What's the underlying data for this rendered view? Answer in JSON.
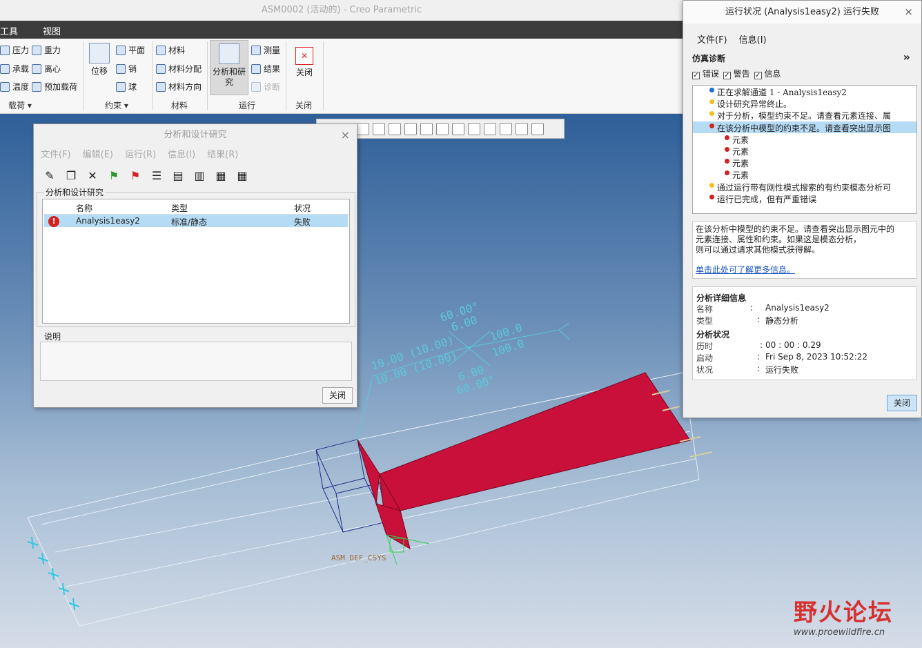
{
  "app": {
    "title": "ASM0002 (活动的) - Creo Parametric",
    "menus": [
      "工具",
      "视图"
    ]
  },
  "ribbon": {
    "loads": {
      "items": [
        "压力",
        "重力",
        "承载",
        "离心",
        "温度",
        "预加载荷"
      ],
      "group": "载荷 ▾"
    },
    "constraints": {
      "big": "位移",
      "items": [
        "平面",
        "销",
        "球"
      ],
      "group": "约束 ▾"
    },
    "materials": {
      "items": [
        "材料",
        "材料分配",
        "材料方向"
      ],
      "group": "材料"
    },
    "run": {
      "big": "分析和研究",
      "items": [
        "测量",
        "结果",
        "诊断"
      ],
      "group": "运行"
    },
    "close": {
      "big": "关闭",
      "group": "关闭"
    }
  },
  "dialog_studies": {
    "title": "分析和设计研究",
    "close": "×",
    "menus": [
      "文件(F)",
      "编辑(E)",
      "运行(R)",
      "信息(I)",
      "结果(R)"
    ],
    "group_label": "分析和设计研究",
    "columns": [
      "名称",
      "类型",
      "状况"
    ],
    "rows": [
      {
        "name": "Analysis1easy2",
        "type": "标准/静态",
        "status": "失败"
      }
    ],
    "desc_label": "说明",
    "close_button": "关闭"
  },
  "dialog_status": {
    "title": "运行状况 (Analysis1easy2) 运行失败",
    "close": "×",
    "menus": [
      "文件(F)",
      "信息(I)"
    ],
    "section": "仿真诊断",
    "expand": "»",
    "filters": [
      "错误",
      "警告",
      "信息"
    ],
    "messages": [
      {
        "text": "正在求解通道 1 - Analysis1easy2",
        "color": "#1a6fd6",
        "indent": 0
      },
      {
        "text": "设计研究异常终止。",
        "color": "#f0c020",
        "indent": 0
      },
      {
        "text": "对于分析，模型约束不足。请查看元素连接、属",
        "color": "#f0c020",
        "indent": 0
      },
      {
        "text": "在该分析中模型的约束不足。请查看突出显示图",
        "color": "#d42020",
        "indent": 0,
        "selected": true
      },
      {
        "text": "元素",
        "color": "#d42020",
        "indent": 1
      },
      {
        "text": "元素",
        "color": "#d42020",
        "indent": 1
      },
      {
        "text": "元素",
        "color": "#d42020",
        "indent": 1
      },
      {
        "text": "元素",
        "color": "#d42020",
        "indent": 1
      },
      {
        "text": "通过运行带有刚性模式搜索的有约束模态分析可",
        "color": "#f0c020",
        "indent": 0
      },
      {
        "text": "运行已完成，但有严重错误",
        "color": "#d42020",
        "indent": 0
      }
    ],
    "explain": [
      "在该分析中模型的约束不足。请查看突出显示图元中的",
      "元素连接、属性和约束。如果这是模态分析，",
      "则可以通过请求其他模式获得解。"
    ],
    "help_link": "单击此处可了解更多信息。",
    "details": {
      "header1": "分析详细信息",
      "name_label": "名称",
      "name_value": "Analysis1easy2",
      "type_label": "类型",
      "type_value": "静态分析",
      "header2": "分析状况",
      "elapsed_label": "历时",
      "elapsed_value": "00 : 00 : 0.29",
      "start_label": "启动",
      "start_value": "Fri Sep  8, 2023    10:52:22",
      "state_label": "状况",
      "state_value": "运行失败"
    },
    "close_button": "关闭"
  },
  "viewport": {
    "annotations": [
      "60.00°",
      "6.00",
      "10.00 (10.00)",
      "10.00 (10.00)",
      "100.0",
      "100.0",
      "6.00",
      "60.00°"
    ],
    "csys_label": "ASM_DEF_CSYS"
  },
  "watermark": {
    "brand": "野火论坛",
    "url": "www.proewildfire.cn"
  }
}
